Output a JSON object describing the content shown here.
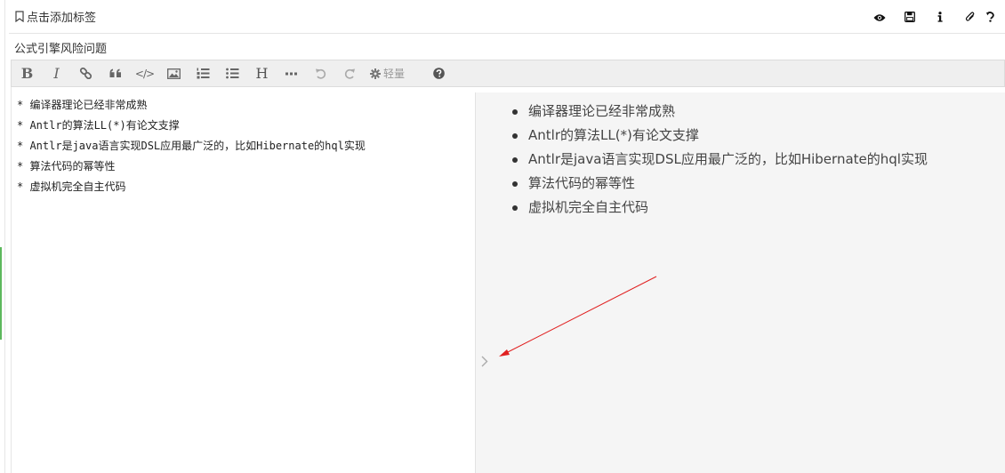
{
  "header": {
    "tag_button_label": "点击添加标签",
    "actions": [
      "preview-icon",
      "save-icon",
      "info-icon",
      "attachment-icon",
      "history-icon"
    ]
  },
  "note": {
    "title": "公式引擎风险问题"
  },
  "toolbar": {
    "bold_label": "B",
    "italic_label": "I",
    "code_label": "</>",
    "heading_label": "H",
    "light_mode_label": "轻量"
  },
  "editor": {
    "lines": [
      "* 编译器理论已经非常成熟",
      "* Antlr的算法LL(*)有论文支撑",
      "* Antlr是java语言实现DSL应用最广泛的，比如Hibernate的hql实现",
      "* 算法代码的幂等性",
      "* 虚拟机完全自主代码"
    ]
  },
  "preview": {
    "items": [
      "编译器理论已经非常成熟",
      "Antlr的算法LL(*)有论文支撑",
      "Antlr是java语言实现DSL应用最广泛的，比如Hibernate的hql实现",
      "算法代码的幂等性",
      "虚拟机完全自主代码"
    ]
  },
  "colors": {
    "annotation_arrow": "#e02020",
    "toolbar_bg": "#efefef",
    "preview_bg": "#f5f5f5",
    "left_stripe": "#5cb85c"
  }
}
